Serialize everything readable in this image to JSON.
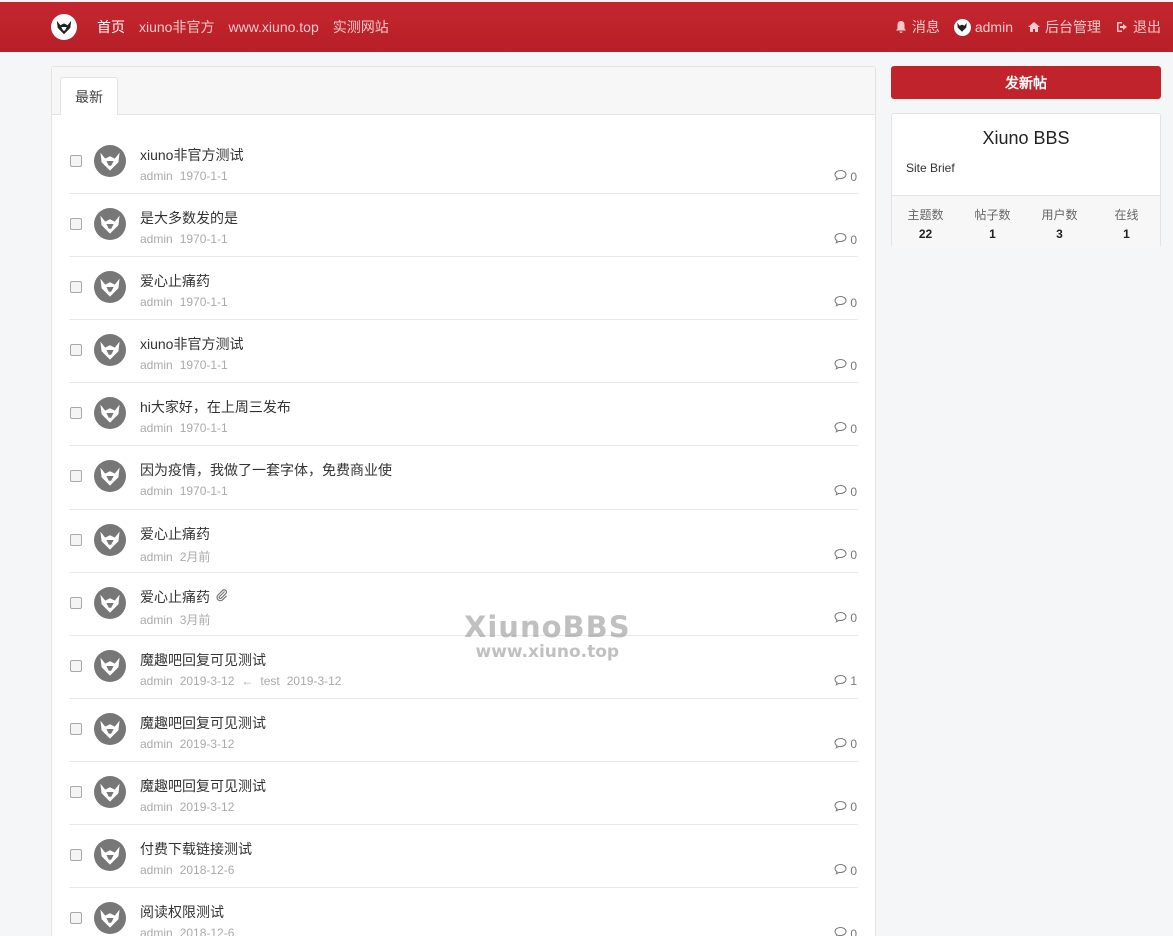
{
  "nav": {
    "links": [
      "首页",
      "xiuno非官方",
      "www.xiuno.top",
      "实测网站"
    ],
    "messages": "消息",
    "user": "admin",
    "admin_panel": "后台管理",
    "logout": "退出"
  },
  "tabs": {
    "latest": "最新"
  },
  "threads": [
    {
      "subject": "xiuno非官方测试",
      "author": "admin",
      "date": "1970-1-1",
      "last_arrow": "",
      "last_user": "",
      "last_date": "",
      "replies": "0",
      "attachment": false
    },
    {
      "subject": "是大多数发的是",
      "author": "admin",
      "date": "1970-1-1",
      "last_arrow": "",
      "last_user": "",
      "last_date": "",
      "replies": "0",
      "attachment": false
    },
    {
      "subject": "爱心止痛药",
      "author": "admin",
      "date": "1970-1-1",
      "last_arrow": "",
      "last_user": "",
      "last_date": "",
      "replies": "0",
      "attachment": false
    },
    {
      "subject": "xiuno非官方测试",
      "author": "admin",
      "date": "1970-1-1",
      "last_arrow": "",
      "last_user": "",
      "last_date": "",
      "replies": "0",
      "attachment": false
    },
    {
      "subject": "hi大家好，在上周三发布",
      "author": "admin",
      "date": "1970-1-1",
      "last_arrow": "",
      "last_user": "",
      "last_date": "",
      "replies": "0",
      "attachment": false
    },
    {
      "subject": "因为疫情，我做了一套字体，免费商业使",
      "author": "admin",
      "date": "1970-1-1",
      "last_arrow": "",
      "last_user": "",
      "last_date": "",
      "replies": "0",
      "attachment": false
    },
    {
      "subject": "爱心止痛药",
      "author": "admin",
      "date": "2月前",
      "last_arrow": "",
      "last_user": "",
      "last_date": "",
      "replies": "0",
      "attachment": false
    },
    {
      "subject": "爱心止痛药",
      "author": "admin",
      "date": "3月前",
      "last_arrow": "",
      "last_user": "",
      "last_date": "",
      "replies": "0",
      "attachment": true
    },
    {
      "subject": "魔趣吧回复可见测试",
      "author": "admin",
      "date": "2019-3-12",
      "last_arrow": "←",
      "last_user": "test",
      "last_date": "2019-3-12",
      "replies": "1",
      "attachment": false
    },
    {
      "subject": "魔趣吧回复可见测试",
      "author": "admin",
      "date": "2019-3-12",
      "last_arrow": "",
      "last_user": "",
      "last_date": "",
      "replies": "0",
      "attachment": false
    },
    {
      "subject": "魔趣吧回复可见测试",
      "author": "admin",
      "date": "2019-3-12",
      "last_arrow": "",
      "last_user": "",
      "last_date": "",
      "replies": "0",
      "attachment": false
    },
    {
      "subject": "付费下载链接测试",
      "author": "admin",
      "date": "2018-12-6",
      "last_arrow": "",
      "last_user": "",
      "last_date": "",
      "replies": "0",
      "attachment": false
    },
    {
      "subject": "阅读权限测试",
      "author": "admin",
      "date": "2018-12-6",
      "last_arrow": "",
      "last_user": "",
      "last_date": "",
      "replies": "0",
      "attachment": false
    }
  ],
  "sidebar": {
    "new_thread": "发新帖",
    "site_name": "Xiuno BBS",
    "site_brief": "Site Brief",
    "stats": [
      {
        "label": "主题数",
        "value": "22"
      },
      {
        "label": "帖子数",
        "value": "1"
      },
      {
        "label": "用户数",
        "value": "3"
      },
      {
        "label": "在线",
        "value": "1"
      }
    ]
  },
  "watermark": {
    "line1": "XiunoBBS",
    "line2": "www.xiuno.top"
  },
  "colors": {
    "brand": "#c0222b"
  }
}
